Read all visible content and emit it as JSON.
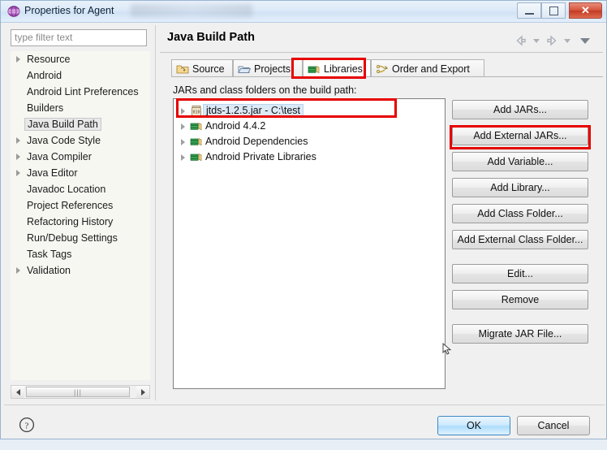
{
  "window": {
    "title": "Properties for Agent",
    "icon": "properties-sphere-icon",
    "minimize_label": "Minimize",
    "maximize_label": "Maximize",
    "close_label": "Close"
  },
  "sidebar": {
    "filter": {
      "placeholder": "type filter text",
      "value": ""
    },
    "items": [
      {
        "label": "Resource",
        "expandable": true,
        "selected": false
      },
      {
        "label": "Android",
        "expandable": false,
        "selected": false
      },
      {
        "label": "Android Lint Preferences",
        "expandable": false,
        "selected": false
      },
      {
        "label": "Builders",
        "expandable": false,
        "selected": false
      },
      {
        "label": "Java Build Path",
        "expandable": false,
        "selected": true
      },
      {
        "label": "Java Code Style",
        "expandable": true,
        "selected": false
      },
      {
        "label": "Java Compiler",
        "expandable": true,
        "selected": false
      },
      {
        "label": "Java Editor",
        "expandable": true,
        "selected": false
      },
      {
        "label": "Javadoc Location",
        "expandable": false,
        "selected": false
      },
      {
        "label": "Project References",
        "expandable": false,
        "selected": false
      },
      {
        "label": "Refactoring History",
        "expandable": false,
        "selected": false
      },
      {
        "label": "Run/Debug Settings",
        "expandable": false,
        "selected": false
      },
      {
        "label": "Task Tags",
        "expandable": false,
        "selected": false
      },
      {
        "label": "Validation",
        "expandable": true,
        "selected": false
      }
    ],
    "scrollbar": {
      "left_icon": "scroll-left-icon",
      "right_icon": "scroll-right-icon",
      "grip": "|||"
    }
  },
  "page": {
    "title": "Java Build Path",
    "nav": {
      "back_icon": "back-arrow-icon",
      "back_menu_icon": "chevron-down-icon",
      "forward_icon": "forward-arrow-icon",
      "forward_menu_icon": "chevron-down-icon",
      "view_menu_icon": "chevron-down-icon"
    }
  },
  "tabs": [
    {
      "label": "Source",
      "icon": "source-folder-icon",
      "active": false,
      "highlighted": false
    },
    {
      "label": "Projects",
      "icon": "open-folder-icon",
      "active": false,
      "highlighted": false
    },
    {
      "label": "Libraries",
      "icon": "books-icon",
      "active": true,
      "highlighted": true
    },
    {
      "label": "Order and Export",
      "icon": "order-export-icon",
      "active": false,
      "highlighted": false
    }
  ],
  "libraries": {
    "list_label": "JARs and class folders on the build path:",
    "entries": [
      {
        "label": "jtds-1.2.5.jar - C:\\test",
        "icon": "jar-icon",
        "selected": true,
        "highlighted": true
      },
      {
        "label": "Android 4.4.2",
        "icon": "library-icon",
        "selected": false,
        "highlighted": false
      },
      {
        "label": "Android Dependencies",
        "icon": "library-icon",
        "selected": false,
        "highlighted": false
      },
      {
        "label": "Android Private Libraries",
        "icon": "library-icon",
        "selected": false,
        "highlighted": false
      }
    ]
  },
  "buttons": {
    "group1": [
      {
        "label": "Add JARs...",
        "highlighted": false
      },
      {
        "label": "Add External JARs...",
        "highlighted": true
      },
      {
        "label": "Add Variable...",
        "highlighted": false
      },
      {
        "label": "Add Library...",
        "highlighted": false
      },
      {
        "label": "Add Class Folder...",
        "highlighted": false
      },
      {
        "label": "Add External Class Folder...",
        "highlighted": false
      }
    ],
    "group2": [
      {
        "label": "Edit...",
        "highlighted": false
      },
      {
        "label": "Remove",
        "highlighted": false
      }
    ],
    "group3": [
      {
        "label": "Migrate JAR File...",
        "highlighted": false
      }
    ]
  },
  "footer": {
    "help_icon": "help-question-icon",
    "ok_label": "OK",
    "cancel_label": "Cancel"
  },
  "colors": {
    "highlight_red": "#e60000",
    "selection_blue": "#dce9f7",
    "default_button_blue": "#aeddfb"
  }
}
